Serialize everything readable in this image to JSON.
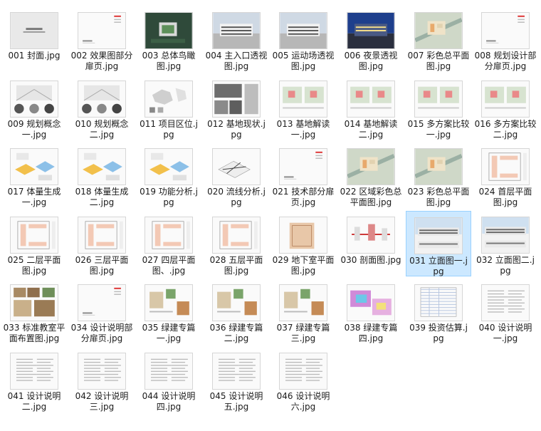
{
  "files": [
    {
      "name": "001 封面.jpg",
      "thumb": "cover"
    },
    {
      "name": "002 效果图部分扉页.jpg",
      "thumb": "divider"
    },
    {
      "name": "003 总体鸟瞰图.jpg",
      "thumb": "aerial"
    },
    {
      "name": "004 主入口透视图.jpg",
      "thumb": "render"
    },
    {
      "name": "005 运动场透视图.jpg",
      "thumb": "render"
    },
    {
      "name": "006 夜景透视图.jpg",
      "thumb": "night"
    },
    {
      "name": "007 彩色总平面图.jpg",
      "thumb": "siteplan"
    },
    {
      "name": "008 规划设计部分扉页.jpg",
      "thumb": "divider"
    },
    {
      "name": "009 规划概念一.jpg",
      "thumb": "concept"
    },
    {
      "name": "010 规划概念二.jpg",
      "thumb": "concept"
    },
    {
      "name": "011 项目区位.jpg",
      "thumb": "map"
    },
    {
      "name": "012 基地现状.jpg",
      "thumb": "photos"
    },
    {
      "name": "013 基地解读一.jpg",
      "thumb": "analysis"
    },
    {
      "name": "014 基地解读二.jpg",
      "thumb": "analysis"
    },
    {
      "name": "015 多方案比较一.jpg",
      "thumb": "analysis"
    },
    {
      "name": "016 多方案比较二.jpg",
      "thumb": "analysis"
    },
    {
      "name": "017 体量生成一.jpg",
      "thumb": "volume"
    },
    {
      "name": "018 体量生成二.jpg",
      "thumb": "volume"
    },
    {
      "name": "019 功能分析.jpg",
      "thumb": "volume"
    },
    {
      "name": "020 流线分析.jpg",
      "thumb": "flow"
    },
    {
      "name": "021 技术部分扉页.jpg",
      "thumb": "divider"
    },
    {
      "name": "022 区域彩色总平面图.jpg",
      "thumb": "siteplan"
    },
    {
      "name": "023 彩色总平面图.jpg",
      "thumb": "siteplan"
    },
    {
      "name": "024 首层平面图.jpg",
      "thumb": "floorplan"
    },
    {
      "name": "025 二层平面图.jpg",
      "thumb": "floorplan"
    },
    {
      "name": "026 三层平面图.jpg",
      "thumb": "floorplan"
    },
    {
      "name": "027 四层平面图、.jpg",
      "thumb": "floorplan"
    },
    {
      "name": "028 五层平面图.jpg",
      "thumb": "floorplan"
    },
    {
      "name": "029 地下室平面图.jpg",
      "thumb": "basement"
    },
    {
      "name": "030 剖面图.jpg",
      "thumb": "section"
    },
    {
      "name": "031 立面图一.jpg",
      "thumb": "elevation"
    },
    {
      "name": "032 立面图二.jpg",
      "thumb": "elevation"
    },
    {
      "name": "033 标准教室平面布置图.jpg",
      "thumb": "classroom"
    },
    {
      "name": "034 设计说明部分扉页.jpg",
      "thumb": "divider"
    },
    {
      "name": "035 绿建专篇一.jpg",
      "thumb": "green"
    },
    {
      "name": "036 绿建专篇二.jpg",
      "thumb": "green"
    },
    {
      "name": "037 绿建专篇三.jpg",
      "thumb": "green"
    },
    {
      "name": "038 绿建专篇四.jpg",
      "thumb": "heatmap"
    },
    {
      "name": "039 投资估算.jpg",
      "thumb": "table"
    },
    {
      "name": "040 设计说明一.jpg",
      "thumb": "text"
    },
    {
      "name": "041 设计说明二.jpg",
      "thumb": "text"
    },
    {
      "name": "042 设计说明三.jpg",
      "thumb": "text"
    },
    {
      "name": "044 设计说明四.jpg",
      "thumb": "text"
    },
    {
      "name": "045 设计说明五.jpg",
      "thumb": "text"
    },
    {
      "name": "046 设计说明六.jpg",
      "thumb": "text"
    }
  ],
  "selected_index": 30
}
